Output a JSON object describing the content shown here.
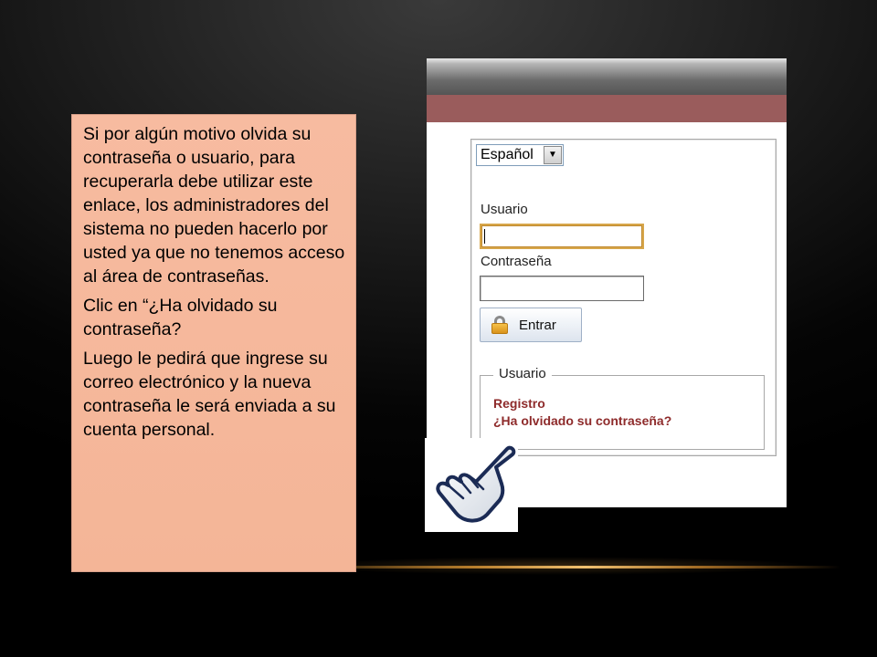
{
  "note": {
    "paragraphs": [
      "Si por algún motivo olvida su contraseña o usuario, para recuperarla debe utilizar este enlace, los administradores del sistema no pueden hacerlo por usted ya que no tenemos acceso al área de contraseñas.",
      "Clic en “¿Ha olvidado su contraseña?",
      "Luego le pedirá que ingrese su correo electrónico y la nueva contraseña le será enviada a su cuenta personal."
    ]
  },
  "login": {
    "language": "Español",
    "username_label": "Usuario",
    "password_label": "Contraseña",
    "username_value": "",
    "password_value": "",
    "submit_label": "Entrar",
    "user_section_title": "Usuario",
    "register_link": "Registro",
    "forgot_link": "¿Ha olvidado su contraseña?"
  },
  "icons": {
    "dropdown": "chevron-down-icon",
    "lock": "lock-icon",
    "cursor": "hand-pointer-icon"
  },
  "colors": {
    "note_bg": "#f4b597",
    "header_bar": "#9a5c5c",
    "link": "#8e2b2b",
    "focus_border": "#d7a64a"
  }
}
